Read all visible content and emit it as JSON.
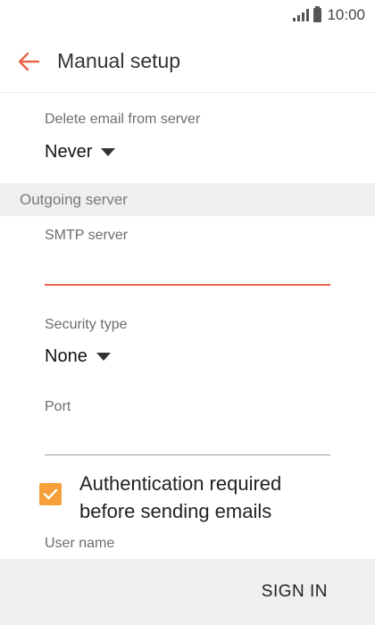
{
  "status_bar": {
    "time": "10:00"
  },
  "app_bar": {
    "title": "Manual setup",
    "accent": "#e8654a"
  },
  "delete_email": {
    "label": "Delete email from server",
    "value": "Never"
  },
  "outgoing_section": {
    "title": "Outgoing server"
  },
  "smtp": {
    "label": "SMTP server",
    "value": "",
    "placeholder": ""
  },
  "security": {
    "label": "Security type",
    "value": "None"
  },
  "port": {
    "label": "Port",
    "value": ""
  },
  "auth": {
    "label_line1": "Authentication required",
    "label_line2": "before sending emails",
    "checked": true,
    "color": "#f6a03a"
  },
  "username": {
    "label": "User name"
  },
  "footer": {
    "sign_in_label": "SIGN IN"
  }
}
